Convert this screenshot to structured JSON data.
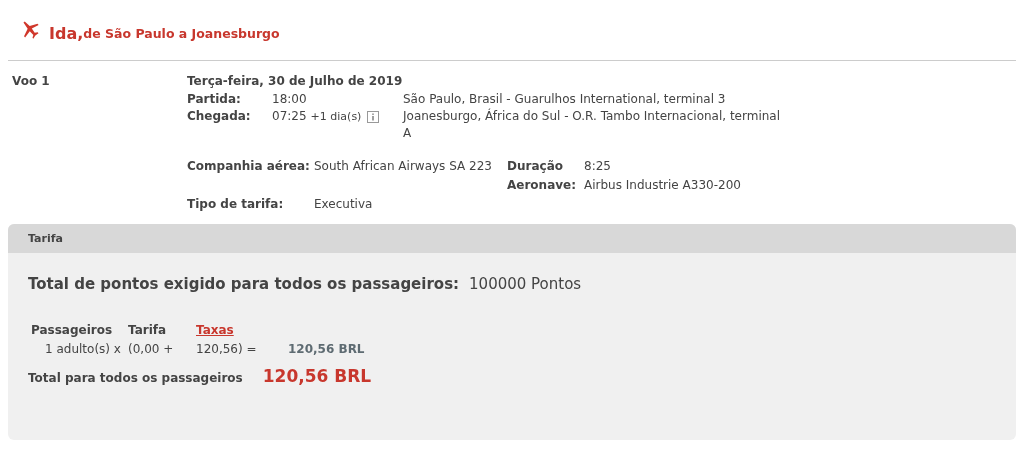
{
  "header": {
    "title": "Ida,",
    "route": "de São Paulo a Joanesburgo"
  },
  "flight": {
    "label": "Voo 1",
    "date": "Terça-feira, 30 de Julho de 2019",
    "departure": {
      "label": "Partida:",
      "time": "18:00",
      "location": "São Paulo, Brasil - Guarulhos International, terminal 3"
    },
    "arrival": {
      "label": "Chegada:",
      "time": "07:25",
      "day_offset": "+1 dia(s)",
      "location": "Joanesburgo, África do Sul - O.R. Tambo Internacional, terminal A"
    },
    "airline": {
      "label": "Companhia aérea:",
      "value": "South African Airways SA 223"
    },
    "duration": {
      "label": "Duração",
      "value": "8:25"
    },
    "aircraft": {
      "label": "Aeronave:",
      "value": "Airbus Industrie A330-200"
    },
    "fare_type": {
      "label": "Tipo de tarifa:",
      "value": "Executiva"
    }
  },
  "fare": {
    "title": "Tarifa",
    "points_label": "Total de pontos exigido para todos os passageiros:",
    "points_value": "100000 Pontos",
    "columns": [
      {
        "label": "Passageiros",
        "kind": "text"
      },
      {
        "label": "Tarifa",
        "kind": "text"
      },
      {
        "label": "Taxas",
        "kind": "link"
      }
    ],
    "rows": [
      {
        "passengers": "1 adulto(s) x",
        "fare": "(0,00 +",
        "taxes": "120,56) =",
        "total": "120,56 BRL"
      }
    ],
    "total_label": "Total para todos os passageiros",
    "total_value": "120,56 BRL"
  }
}
